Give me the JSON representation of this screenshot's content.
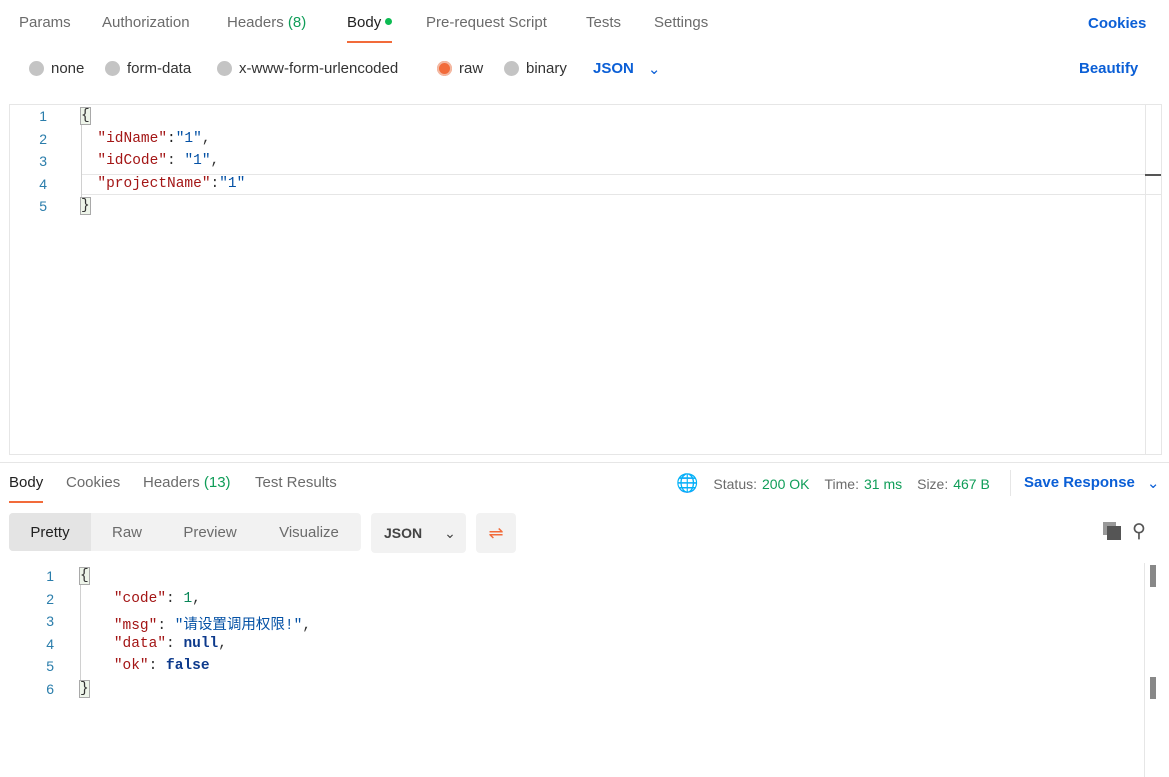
{
  "request_tabs": [
    {
      "label": "Params"
    },
    {
      "label": "Authorization"
    },
    {
      "label": "Headers",
      "count": "(8)"
    },
    {
      "label": "Body"
    },
    {
      "label": "Pre-request Script"
    },
    {
      "label": "Tests"
    },
    {
      "label": "Settings"
    }
  ],
  "cookies_link": "Cookies",
  "body_types": [
    "none",
    "form-data",
    "x-www-form-urlencoded",
    "raw",
    "binary"
  ],
  "selected_body_type": "raw",
  "language": "JSON",
  "beautify": "Beautify",
  "request_code": [
    [
      [
        "{",
        "p brace"
      ]
    ],
    [
      [
        "  ",
        ""
      ],
      [
        "\"idName\"",
        "key"
      ],
      [
        ":",
        ""
      ],
      [
        "\"1\"",
        "str"
      ],
      [
        ",",
        "p"
      ]
    ],
    [
      [
        "  ",
        ""
      ],
      [
        "\"idCode\"",
        "key"
      ],
      [
        ": ",
        "p"
      ],
      [
        "\"1\"",
        "str"
      ],
      [
        ",",
        "p"
      ]
    ],
    [
      [
        "  ",
        ""
      ],
      [
        "\"projectName\"",
        "key"
      ],
      [
        ":",
        "p"
      ],
      [
        "\"1\"",
        "str"
      ]
    ],
    [
      [
        "}",
        "p brace"
      ]
    ]
  ],
  "response_tabs": [
    {
      "label": "Body"
    },
    {
      "label": "Cookies"
    },
    {
      "label": "Headers",
      "count": "(13)"
    },
    {
      "label": "Test Results"
    }
  ],
  "status": {
    "status_label": "Status:",
    "status": "200 OK",
    "time_label": "Time:",
    "time": "31 ms",
    "size_label": "Size:",
    "size": "467 B"
  },
  "save_response": "Save Response",
  "view_modes": [
    "Pretty",
    "Raw",
    "Preview",
    "Visualize"
  ],
  "response_format": "JSON",
  "response_code": [
    [
      [
        "{",
        "p brace"
      ]
    ],
    [
      [
        "    ",
        ""
      ],
      [
        "\"code\"",
        "key"
      ],
      [
        ": ",
        "p"
      ],
      [
        "1",
        "num"
      ],
      [
        ",",
        "p"
      ]
    ],
    [
      [
        "    ",
        ""
      ],
      [
        "\"msg\"",
        "key"
      ],
      [
        ": ",
        "p"
      ],
      [
        "\"请设置调用权限!\"",
        "str"
      ],
      [
        ",",
        "p"
      ]
    ],
    [
      [
        "    ",
        ""
      ],
      [
        "\"data\"",
        "key"
      ],
      [
        ": ",
        "p"
      ],
      [
        "null",
        "kw"
      ],
      [
        ",",
        "p"
      ]
    ],
    [
      [
        "    ",
        ""
      ],
      [
        "\"ok\"",
        "key"
      ],
      [
        ": ",
        "p"
      ],
      [
        "false",
        "kw"
      ]
    ],
    [
      [
        "}",
        "p brace"
      ]
    ]
  ]
}
